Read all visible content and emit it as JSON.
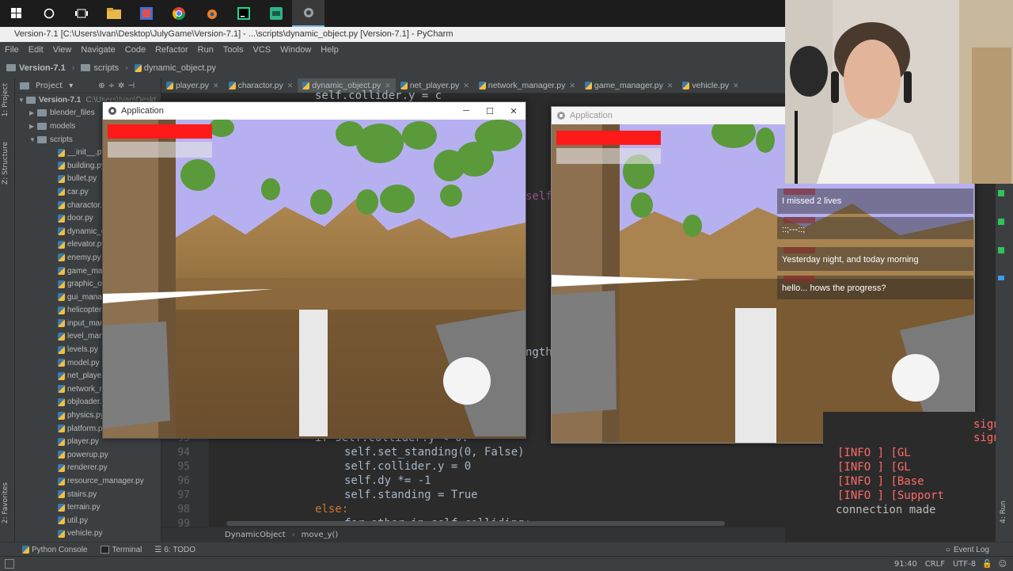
{
  "taskbar": {
    "icons": [
      "windows-start-icon",
      "cortana-icon",
      "task-view-icon",
      "file-explorer-icon",
      "blender-icon",
      "chrome-icon",
      "blender2-icon",
      "pycharm-icon",
      "terminal-icon",
      "app-icon"
    ]
  },
  "window": {
    "title": "Version-7.1 [C:\\Users\\Ivan\\Desktop\\JulyGame\\Version-7.1] - ...\\scripts\\dynamic_object.py [Version-7.1] - PyCharm"
  },
  "menu": [
    "File",
    "Edit",
    "View",
    "Navigate",
    "Code",
    "Refactor",
    "Run",
    "Tools",
    "VCS",
    "Window",
    "Help"
  ],
  "nav": {
    "project": "Version-7.1",
    "folder": "scripts",
    "file": "dynamic_object.py"
  },
  "project_panel": {
    "header": "Project",
    "root": "Version-7.1",
    "root_path": "C:\\Users\\Ivan\\Deskt",
    "folders": [
      "blender_files",
      "models",
      "scripts"
    ],
    "files": [
      "__init__.py",
      "building.py",
      "bullet.py",
      "car.py",
      "charactor.py",
      "door.py",
      "dynamic_object.py",
      "elevator.py",
      "enemy.py",
      "game_manager.py",
      "graphic_object.py",
      "gui_manager.py",
      "helicopter.py",
      "input_manager.py",
      "level_manager.py",
      "levels.py",
      "model.py",
      "net_player.py",
      "network_manager.py",
      "objloader.py",
      "physics.py",
      "platform.py",
      "player.py",
      "powerup.py",
      "renderer.py",
      "resource_manager.py",
      "stairs.py",
      "terrain.py",
      "util.py",
      "vehicle.py"
    ]
  },
  "tabs": [
    "player.py",
    "charactor.py",
    "dynamic_object.py",
    "net_player.py",
    "network_manager.py",
    "game_manager.py",
    "vehicle.py"
  ],
  "code": {
    "top": "self.collider.y = c",
    "right1": "self",
    "right2": "ngth",
    "lines": [
      {
        "n": "93",
        "text": "if self.collider.y < 0:"
      },
      {
        "n": "94",
        "text": "self.set_standing(0, False)"
      },
      {
        "n": "95",
        "text": "self.collider.y = 0"
      },
      {
        "n": "96",
        "text": "self.dy *= -1"
      },
      {
        "n": "97",
        "text": "self.standing = True"
      },
      {
        "n": "98",
        "text": "else:"
      },
      {
        "n": "99",
        "text": "for other in self.colliding:"
      }
    ]
  },
  "editor_breadcrumb": {
    "cls": "DynamicObject",
    "fn": "move_y()"
  },
  "app_window_1": {
    "title": "Application"
  },
  "app_window_2": {
    "title": "Application"
  },
  "chat": [
    {
      "msg": "I missed 2 lives"
    },
    {
      "msg": "::;---::;"
    },
    {
      "msg": "Yesterday night, and today morning"
    },
    {
      "msg": "hello... hows the progress?"
    }
  ],
  "console": {
    "side": [
      "sign",
      "sign"
    ],
    "lines": [
      {
        "tag": "[INFO   ]",
        "val": "[GL"
      },
      {
        "tag": "[INFO   ]",
        "val": "[GL"
      },
      {
        "tag": "[INFO   ]",
        "val": "[Base"
      },
      {
        "tag": "[INFO   ]",
        "val": "[Support"
      }
    ],
    "last": "connection made"
  },
  "bottom_tools": [
    "Python Console",
    "Terminal",
    "6: TODO"
  ],
  "event_log": "Event Log",
  "status": {
    "pos": "91:40",
    "eol": "CRLF",
    "enc": "UTF-8"
  },
  "sidebar_labels": {
    "project": "1: Project",
    "structure": "Z: Structure",
    "favorites": "2: Favorites",
    "run": "4: Run"
  }
}
